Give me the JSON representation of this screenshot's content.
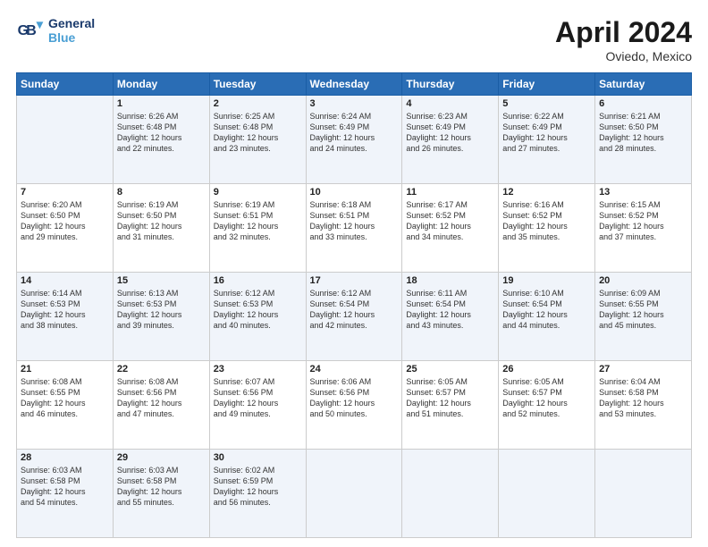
{
  "header": {
    "logo_line1": "General",
    "logo_line2": "Blue",
    "month": "April 2024",
    "location": "Oviedo, Mexico"
  },
  "days_of_week": [
    "Sunday",
    "Monday",
    "Tuesday",
    "Wednesday",
    "Thursday",
    "Friday",
    "Saturday"
  ],
  "weeks": [
    [
      {
        "num": "",
        "info": ""
      },
      {
        "num": "1",
        "info": "Sunrise: 6:26 AM\nSunset: 6:48 PM\nDaylight: 12 hours\nand 22 minutes."
      },
      {
        "num": "2",
        "info": "Sunrise: 6:25 AM\nSunset: 6:48 PM\nDaylight: 12 hours\nand 23 minutes."
      },
      {
        "num": "3",
        "info": "Sunrise: 6:24 AM\nSunset: 6:49 PM\nDaylight: 12 hours\nand 24 minutes."
      },
      {
        "num": "4",
        "info": "Sunrise: 6:23 AM\nSunset: 6:49 PM\nDaylight: 12 hours\nand 26 minutes."
      },
      {
        "num": "5",
        "info": "Sunrise: 6:22 AM\nSunset: 6:49 PM\nDaylight: 12 hours\nand 27 minutes."
      },
      {
        "num": "6",
        "info": "Sunrise: 6:21 AM\nSunset: 6:50 PM\nDaylight: 12 hours\nand 28 minutes."
      }
    ],
    [
      {
        "num": "7",
        "info": "Sunrise: 6:20 AM\nSunset: 6:50 PM\nDaylight: 12 hours\nand 29 minutes."
      },
      {
        "num": "8",
        "info": "Sunrise: 6:19 AM\nSunset: 6:50 PM\nDaylight: 12 hours\nand 31 minutes."
      },
      {
        "num": "9",
        "info": "Sunrise: 6:19 AM\nSunset: 6:51 PM\nDaylight: 12 hours\nand 32 minutes."
      },
      {
        "num": "10",
        "info": "Sunrise: 6:18 AM\nSunset: 6:51 PM\nDaylight: 12 hours\nand 33 minutes."
      },
      {
        "num": "11",
        "info": "Sunrise: 6:17 AM\nSunset: 6:52 PM\nDaylight: 12 hours\nand 34 minutes."
      },
      {
        "num": "12",
        "info": "Sunrise: 6:16 AM\nSunset: 6:52 PM\nDaylight: 12 hours\nand 35 minutes."
      },
      {
        "num": "13",
        "info": "Sunrise: 6:15 AM\nSunset: 6:52 PM\nDaylight: 12 hours\nand 37 minutes."
      }
    ],
    [
      {
        "num": "14",
        "info": "Sunrise: 6:14 AM\nSunset: 6:53 PM\nDaylight: 12 hours\nand 38 minutes."
      },
      {
        "num": "15",
        "info": "Sunrise: 6:13 AM\nSunset: 6:53 PM\nDaylight: 12 hours\nand 39 minutes."
      },
      {
        "num": "16",
        "info": "Sunrise: 6:12 AM\nSunset: 6:53 PM\nDaylight: 12 hours\nand 40 minutes."
      },
      {
        "num": "17",
        "info": "Sunrise: 6:12 AM\nSunset: 6:54 PM\nDaylight: 12 hours\nand 42 minutes."
      },
      {
        "num": "18",
        "info": "Sunrise: 6:11 AM\nSunset: 6:54 PM\nDaylight: 12 hours\nand 43 minutes."
      },
      {
        "num": "19",
        "info": "Sunrise: 6:10 AM\nSunset: 6:54 PM\nDaylight: 12 hours\nand 44 minutes."
      },
      {
        "num": "20",
        "info": "Sunrise: 6:09 AM\nSunset: 6:55 PM\nDaylight: 12 hours\nand 45 minutes."
      }
    ],
    [
      {
        "num": "21",
        "info": "Sunrise: 6:08 AM\nSunset: 6:55 PM\nDaylight: 12 hours\nand 46 minutes."
      },
      {
        "num": "22",
        "info": "Sunrise: 6:08 AM\nSunset: 6:56 PM\nDaylight: 12 hours\nand 47 minutes."
      },
      {
        "num": "23",
        "info": "Sunrise: 6:07 AM\nSunset: 6:56 PM\nDaylight: 12 hours\nand 49 minutes."
      },
      {
        "num": "24",
        "info": "Sunrise: 6:06 AM\nSunset: 6:56 PM\nDaylight: 12 hours\nand 50 minutes."
      },
      {
        "num": "25",
        "info": "Sunrise: 6:05 AM\nSunset: 6:57 PM\nDaylight: 12 hours\nand 51 minutes."
      },
      {
        "num": "26",
        "info": "Sunrise: 6:05 AM\nSunset: 6:57 PM\nDaylight: 12 hours\nand 52 minutes."
      },
      {
        "num": "27",
        "info": "Sunrise: 6:04 AM\nSunset: 6:58 PM\nDaylight: 12 hours\nand 53 minutes."
      }
    ],
    [
      {
        "num": "28",
        "info": "Sunrise: 6:03 AM\nSunset: 6:58 PM\nDaylight: 12 hours\nand 54 minutes."
      },
      {
        "num": "29",
        "info": "Sunrise: 6:03 AM\nSunset: 6:58 PM\nDaylight: 12 hours\nand 55 minutes."
      },
      {
        "num": "30",
        "info": "Sunrise: 6:02 AM\nSunset: 6:59 PM\nDaylight: 12 hours\nand 56 minutes."
      },
      {
        "num": "",
        "info": ""
      },
      {
        "num": "",
        "info": ""
      },
      {
        "num": "",
        "info": ""
      },
      {
        "num": "",
        "info": ""
      }
    ]
  ]
}
